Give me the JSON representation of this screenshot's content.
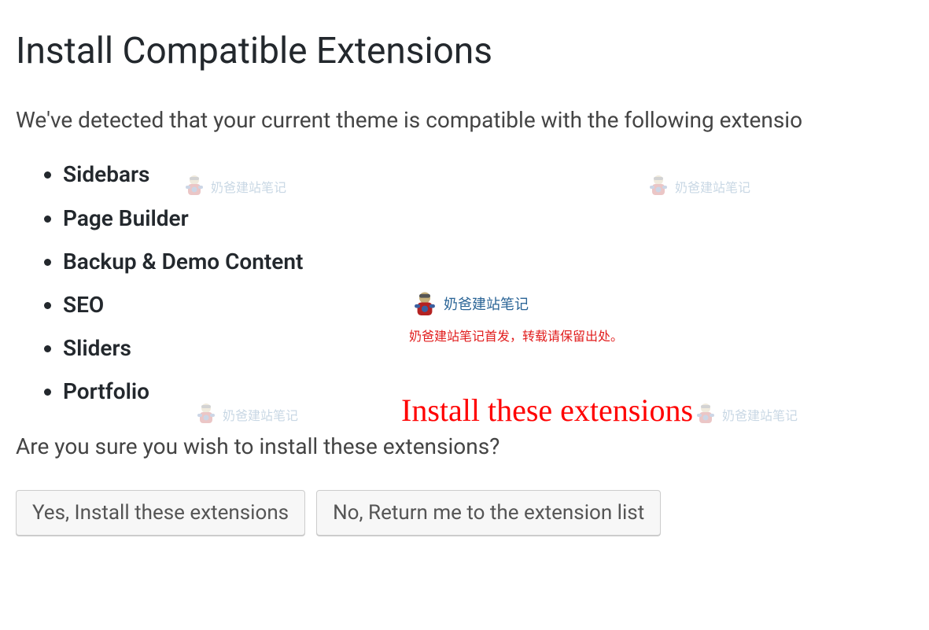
{
  "title": "Install Compatible Extensions",
  "intro": "We've detected that your current theme is compatible with the following extensio",
  "extensions": {
    "0": "Sidebars",
    "1": "Page Builder",
    "2": "Backup & Demo Content",
    "3": "SEO",
    "4": "Sliders",
    "5": "Portfolio"
  },
  "confirm_text": "Are you sure you wish to install these extensions?",
  "buttons": {
    "yes": "Yes, Install these extensions",
    "no": "No, Return me to the extension list"
  },
  "watermark": {
    "text": "奶爸建站笔记"
  },
  "annotation": {
    "title": "奶爸建站笔记",
    "subtitle": "奶爸建站笔记首发，转载请保留出处。",
    "big": "Install these extensions"
  }
}
